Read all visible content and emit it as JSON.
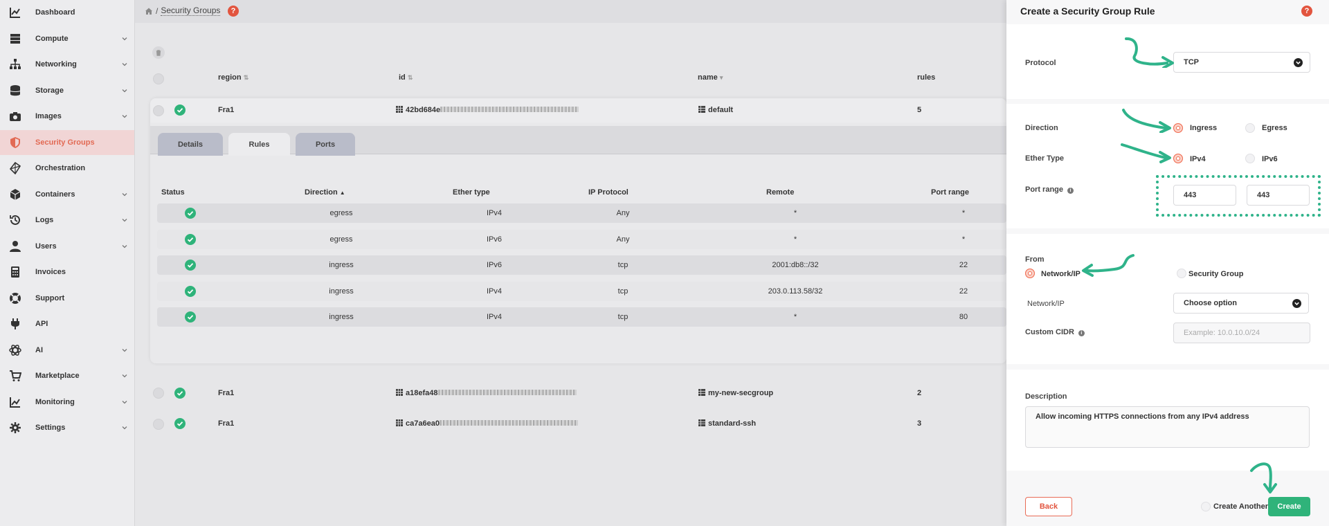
{
  "sidebar": {
    "items": [
      {
        "label": "Dashboard",
        "icon": "chart-line-icon",
        "chevron": false
      },
      {
        "label": "Compute",
        "icon": "server-icon",
        "chevron": true
      },
      {
        "label": "Networking",
        "icon": "network-icon",
        "chevron": true
      },
      {
        "label": "Storage",
        "icon": "database-icon",
        "chevron": true
      },
      {
        "label": "Images",
        "icon": "camera-icon",
        "chevron": true
      },
      {
        "label": "Security Groups",
        "icon": "shield-icon",
        "chevron": false,
        "active": true
      },
      {
        "label": "Orchestration",
        "icon": "orchestration-icon",
        "chevron": false
      },
      {
        "label": "Containers",
        "icon": "cube-icon",
        "chevron": true
      },
      {
        "label": "Logs",
        "icon": "history-icon",
        "chevron": true
      },
      {
        "label": "Users",
        "icon": "user-icon",
        "chevron": true
      },
      {
        "label": "Invoices",
        "icon": "calculator-icon",
        "chevron": false
      },
      {
        "label": "Support",
        "icon": "lifebuoy-icon",
        "chevron": false
      },
      {
        "label": "API",
        "icon": "plug-icon",
        "chevron": false
      },
      {
        "label": "AI",
        "icon": "ai-icon",
        "chevron": true
      },
      {
        "label": "Marketplace",
        "icon": "cart-icon",
        "chevron": true
      },
      {
        "label": "Monitoring",
        "icon": "area-chart-icon",
        "chevron": true
      },
      {
        "label": "Settings",
        "icon": "gear-icon",
        "chevron": true
      }
    ]
  },
  "breadcrumb": {
    "current": "Security Groups"
  },
  "help_glyph": "?",
  "table": {
    "headers": {
      "region": "region",
      "id": "id",
      "name": "name",
      "rules": "rules"
    },
    "rows": [
      {
        "region": "Fra1",
        "id": "42bd684e",
        "name": "default",
        "rules": "5"
      },
      {
        "region": "Fra1",
        "id": "a18efa48",
        "name": "my-new-secgroup",
        "rules": "2"
      },
      {
        "region": "Fra1",
        "id": "ca7a6ea0",
        "name": "standard-ssh",
        "rules": "3"
      }
    ]
  },
  "tabs": [
    "Details",
    "Rules",
    "Ports"
  ],
  "rules": {
    "headers": {
      "status": "Status",
      "direction": "Direction",
      "ether": "Ether type",
      "proto": "IP Protocol",
      "remote": "Remote",
      "port": "Port range"
    },
    "rows": [
      {
        "direction": "egress",
        "ether": "IPv4",
        "proto": "Any",
        "remote": "*",
        "port": "*"
      },
      {
        "direction": "egress",
        "ether": "IPv6",
        "proto": "Any",
        "remote": "*",
        "port": "*"
      },
      {
        "direction": "ingress",
        "ether": "IPv6",
        "proto": "tcp",
        "remote": "2001:db8::/32",
        "port": "22"
      },
      {
        "direction": "ingress",
        "ether": "IPv4",
        "proto": "tcp",
        "remote": "203.0.113.58/32",
        "port": "22"
      },
      {
        "direction": "ingress",
        "ether": "IPv4",
        "proto": "tcp",
        "remote": "*",
        "port": "80"
      }
    ]
  },
  "panel": {
    "title": "Create a Security Group Rule",
    "protocol_label": "Protocol",
    "protocol_value": "TCP",
    "direction_label": "Direction",
    "ingress": "Ingress",
    "egress": "Egress",
    "ether_label": "Ether Type",
    "ipv4": "IPv4",
    "ipv6": "IPv6",
    "port_label": "Port range",
    "port_min": "443",
    "port_max": "443",
    "from_label": "From",
    "network_ip": "Network/IP",
    "security_group": "Security Group",
    "network_field_label": "Network/IP",
    "network_select": "Choose option",
    "cidr_label": "Custom CIDR",
    "cidr_placeholder": "Example: 10.0.10.0/24",
    "description_label": "Description",
    "description_value": "Allow incoming HTTPS connections from any IPv4 address",
    "back": "Back",
    "create_another": "Create Another",
    "create": "Create"
  },
  "colors": {
    "accent": "#e2553f",
    "success": "#2fb37a",
    "annotation": "#2fb38a"
  }
}
